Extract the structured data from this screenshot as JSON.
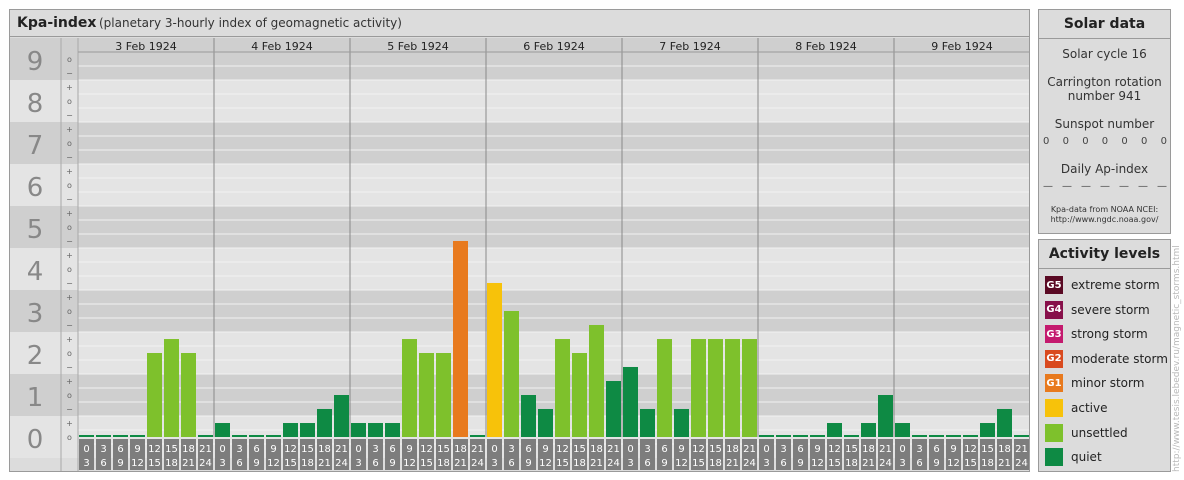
{
  "header": {
    "title": "Kpa-index",
    "subtitle": "(planetary 3-hourly index of geomagnetic activity)"
  },
  "chart_data": {
    "type": "bar",
    "y_axis_labels": [
      "0",
      "1",
      "2",
      "3",
      "4",
      "5",
      "6",
      "7",
      "8",
      "9"
    ],
    "y_minor_labels": [
      "+",
      "−",
      "o"
    ],
    "ylim": [
      0,
      9.33
    ],
    "days": [
      "3 Feb 1924",
      "4 Feb 1924",
      "5 Feb 1924",
      "6 Feb 1924",
      "7 Feb 1924",
      "8 Feb 1924",
      "9 Feb 1924"
    ],
    "interval_labels": [
      [
        "0",
        "3"
      ],
      [
        "3",
        "6"
      ],
      [
        "6",
        "9"
      ],
      [
        "9",
        "12"
      ],
      [
        "12",
        "15"
      ],
      [
        "15",
        "18"
      ],
      [
        "18",
        "21"
      ],
      [
        "21",
        "24"
      ]
    ],
    "values": [
      0,
      0,
      0,
      0,
      2,
      2.333,
      2,
      0,
      0.333,
      0,
      0,
      0,
      0.333,
      0.333,
      0.667,
      1,
      0.333,
      0.333,
      0.333,
      2.333,
      2,
      2,
      4.667,
      0,
      3.667,
      3,
      1,
      0.667,
      2.333,
      2,
      2.667,
      1.333,
      1.667,
      0.667,
      2.333,
      0.667,
      2.333,
      2.333,
      2.333,
      2.333,
      0,
      0,
      0,
      0,
      0.333,
      0,
      0.333,
      1,
      0.333,
      0,
      0,
      0,
      0,
      0.333,
      0.667,
      0
    ]
  },
  "solar": {
    "title": "Solar data",
    "cycle": "Solar cycle 16",
    "carrington_line1": "Carrington rotation",
    "carrington_line2": "number 941",
    "sunspot_label": "Sunspot number",
    "sunspot_values": [
      "0",
      "0",
      "0",
      "0",
      "0",
      "0",
      "0"
    ],
    "ap_label": "Daily Ap-index",
    "ap_values": [
      "—",
      "—",
      "—",
      "—",
      "—",
      "—",
      "—"
    ],
    "note_line1": "Kpa-data from NOAA NCEI:",
    "note_line2": "http://www.ngdc.noaa.gov/"
  },
  "levels": {
    "title": "Activity levels",
    "items": [
      {
        "badge": "G5",
        "label": "extreme storm",
        "color": "#5a0a24"
      },
      {
        "badge": "G4",
        "label": "severe storm",
        "color": "#87104a"
      },
      {
        "badge": "G3",
        "label": "strong storm",
        "color": "#c41a6e"
      },
      {
        "badge": "G2",
        "label": "moderate storm",
        "color": "#d94a1e"
      },
      {
        "badge": "G1",
        "label": "minor storm",
        "color": "#e87a1e"
      },
      {
        "badge": "",
        "label": "active",
        "color": "#f7c20a"
      },
      {
        "badge": "",
        "label": "unsettled",
        "color": "#7ec12c"
      },
      {
        "badge": "",
        "label": "quiet",
        "color": "#0e8a44"
      }
    ]
  },
  "watermark": "http://www.tesis.lebedev.ru/magnetic_storms.html"
}
